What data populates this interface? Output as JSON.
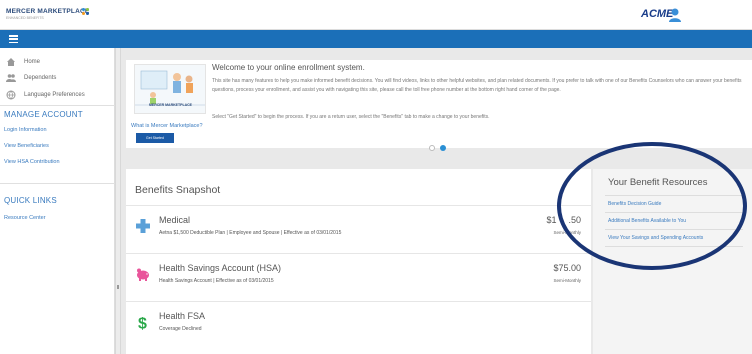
{
  "header": {
    "logo_text": "MERCER MARKETPLACE",
    "logo_sub": "ENHANCED BENEFITS",
    "brand": "ACME"
  },
  "sidebar": {
    "items": [
      {
        "label": "Home",
        "icon": "home-icon"
      },
      {
        "label": "Dependents",
        "icon": "users-icon"
      },
      {
        "label": "Language Preferences",
        "icon": "globe-icon"
      }
    ],
    "manage_title": "MANAGE ACCOUNT",
    "manage_links": [
      "Login Information",
      "View Beneficiaries",
      "View HSA Contribution"
    ],
    "quick_title": "QUICK LINKS",
    "quick_links": [
      "Resource Center"
    ]
  },
  "welcome": {
    "title": "Welcome to your online enrollment system.",
    "body": "This site has many features to help you make informed benefit decisions. You will find videos, links to other helpful websites, and plan related documents. If you prefer to talk with one of our Benefits Counselors who can answer your benefits questions, process your enrollment, and assist you with navigating this site, please call the toll free phone number at the bottom right hand corner of the page.",
    "body2": "Select \"Get Started\" to begin the process. If you are a return user, select the \"Benefits\" tab to make a change to your benefits.",
    "illus_label": "MERCER MARKETPLACE",
    "what_link": "What is Mercer Marketplace?",
    "get_started": "Get Started"
  },
  "snapshot": {
    "title": "Benefits Snapshot",
    "rows": [
      {
        "title": "Medical",
        "sub": "Aetna $1,500 Deductible Plan | Employee and Spouse | Effective as of 03/01/2015",
        "amount": "$1",
        "amount_tail": ".50",
        "freq": "Semi-Monthly",
        "icon": "medical-cross-icon"
      },
      {
        "title": "Health Savings Account (HSA)",
        "sub": "Health Savings Account | Effective as of 03/01/2015",
        "amount": "$75.00",
        "amount_tail": "",
        "freq": "Semi-Monthly",
        "icon": "piggy-bank-icon"
      },
      {
        "title": "Health FSA",
        "sub": "Coverage Declined",
        "amount": "",
        "amount_tail": "",
        "freq": "",
        "icon": "dollar-icon"
      }
    ]
  },
  "resources": {
    "title": "Your Benefit Resources",
    "links": [
      "Benefits Decision Guide",
      "Additional Benefits Available to You",
      "View Your Savings and Spending Accounts"
    ]
  },
  "colors": {
    "nav_blue": "#1b6fb8",
    "link_blue": "#3a7bbf",
    "annotation_oval": "#1a3575"
  }
}
